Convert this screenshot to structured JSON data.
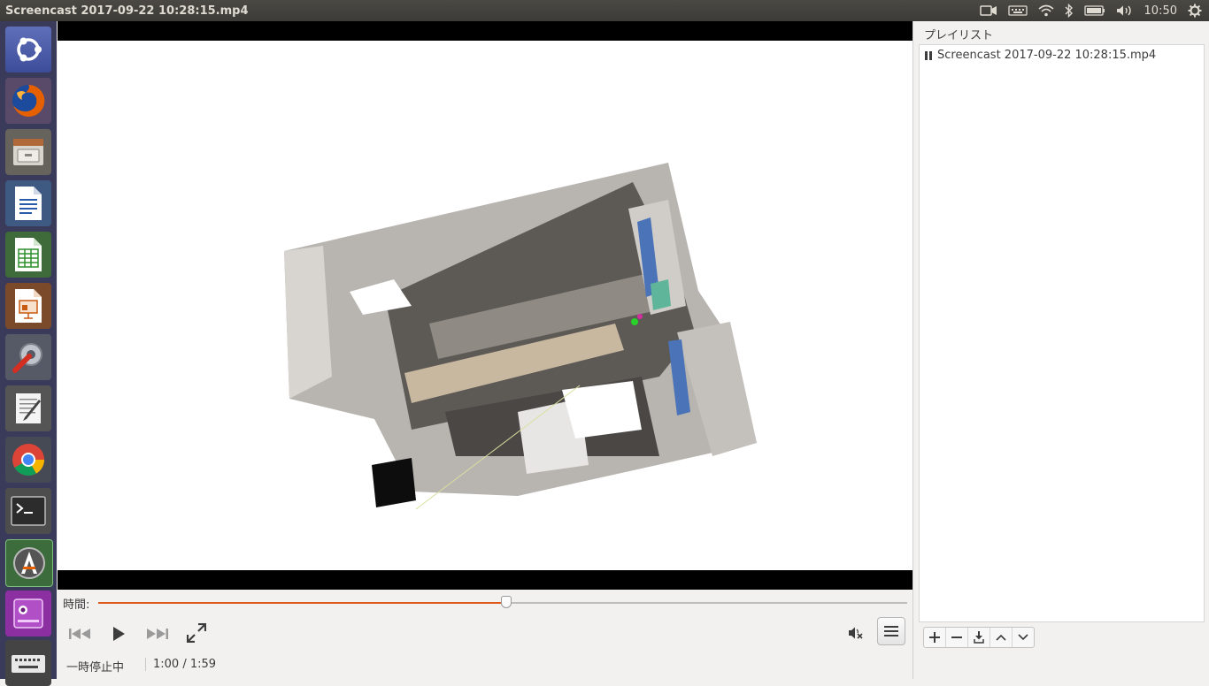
{
  "window": {
    "title": "Screencast 2017-09-22 10:28:15.mp4"
  },
  "panel": {
    "clock": "10:50",
    "indicators": [
      "camera-icon",
      "keyboard-icon",
      "wifi-icon",
      "bluetooth-icon",
      "battery-icon",
      "volume-icon",
      "settings-gear-icon"
    ]
  },
  "launcher": {
    "items": [
      "ubuntu-dash",
      "firefox",
      "files",
      "libreoffice-writer",
      "libreoffice-calc",
      "libreoffice-impress",
      "system-settings",
      "text-editor",
      "chrome",
      "terminal",
      "software-updater",
      "webcam-app",
      "keyboard-app"
    ]
  },
  "player": {
    "time_label": "時間:",
    "progress": 0.5042,
    "status": "一時停止中",
    "time": "1:00 / 1:59"
  },
  "playlist": {
    "header": "プレイリスト",
    "items": [
      {
        "label": "Screencast 2017-09-22 10:28:15.mp4",
        "state": "paused"
      }
    ],
    "buttons": [
      "+",
      "−",
      "⤓",
      "⌃",
      "⌄"
    ]
  },
  "colors": {
    "accent": "#e0591c",
    "panel": "#3c3b37",
    "launcher": "#3a3a5a"
  }
}
